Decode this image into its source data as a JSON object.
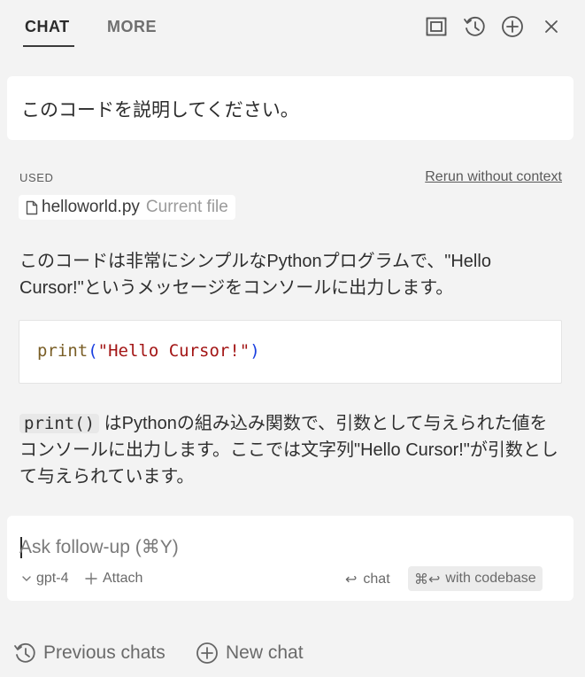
{
  "header": {
    "tabs": [
      {
        "label": "CHAT",
        "active": true
      },
      {
        "label": "MORE",
        "active": false
      }
    ],
    "actions": [
      "maximize-icon",
      "history-icon",
      "add-icon",
      "close-icon"
    ]
  },
  "question": {
    "text": "このコードを説明してください。"
  },
  "context": {
    "used_label": "USED",
    "rerun_label": "Rerun without context",
    "file_name": "helloworld.py",
    "file_desc": "Current file"
  },
  "answer": {
    "paragraph1": "このコードは非常にシンプルなPythonプログラムで、\"Hello Cursor!\"というメッセージをコンソールに出力します。",
    "code": {
      "fn": "print",
      "open": "(",
      "str": "\"Hello Cursor!\"",
      "close": ")"
    },
    "inline_code": "print()",
    "paragraph2_rest": " はPythonの組み込み関数で、引数として与えられた値をコンソールに出力します。ここでは文字列\"Hello Cursor!\"が引数として与えられています。"
  },
  "input": {
    "placeholder": "Ask follow-up (⌘Y)",
    "model": "gpt-4",
    "attach_label": "Attach",
    "chat_label": "chat",
    "codebase_label": "with codebase",
    "chat_glyph": "↩",
    "codebase_glyph": "⌘↩"
  },
  "footer": {
    "previous_chats": "Previous chats",
    "new_chat": "New chat"
  },
  "colors": {
    "background": "#f3f3f3",
    "card": "#ffffff",
    "code_fn": "#795e26",
    "code_paren": "#1a3fe0",
    "code_string": "#a31515"
  }
}
